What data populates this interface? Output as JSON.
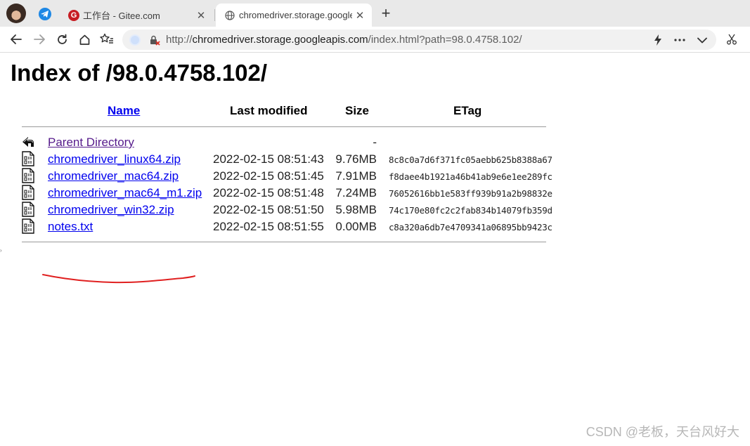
{
  "browser": {
    "tabs": [
      {
        "title": "工作台 - Gitee.com",
        "close": "✕",
        "favicon": "gitee-icon"
      },
      {
        "title": "chromedriver.storage.googleapis.com",
        "close": "✕",
        "favicon": "globe-icon"
      }
    ],
    "pinned_tab_icon": "telegram-icon",
    "new_tab": "+",
    "address": {
      "scheme": "http://",
      "host": "chromedriver.storage.googleapis.com",
      "path": "/index.html?path=98.0.4758.102/"
    },
    "toolbar_icons": [
      "back-icon",
      "forward-icon",
      "reload-icon",
      "home-icon",
      "favorites-icon",
      "lightning-icon",
      "more-icon",
      "chevron-down-icon",
      "scissors-icon"
    ]
  },
  "page": {
    "title": "Index of /98.0.4758.102/",
    "columns": {
      "name": "Name",
      "modified": "Last modified",
      "size": "Size",
      "etag": "ETag"
    },
    "parent": {
      "name": "Parent Directory",
      "size": "-"
    },
    "files": [
      {
        "name": "chromedriver_linux64.zip",
        "modified": "2022-02-15 08:51:43",
        "size": "9.76MB",
        "etag": "8c8c0a7d6f371fc05aebb625b8388a67"
      },
      {
        "name": "chromedriver_mac64.zip",
        "modified": "2022-02-15 08:51:45",
        "size": "7.91MB",
        "etag": "f8daee4b1921a46b41ab9e6e1ee289fc"
      },
      {
        "name": "chromedriver_mac64_m1.zip",
        "modified": "2022-02-15 08:51:48",
        "size": "7.24MB",
        "etag": "76052616bb1e583ff939b91a2b98832e"
      },
      {
        "name": "chromedriver_win32.zip",
        "modified": "2022-02-15 08:51:50",
        "size": "5.98MB",
        "etag": "74c170e80fc2c2fab834b14079fb359d"
      },
      {
        "name": "notes.txt",
        "modified": "2022-02-15 08:51:55",
        "size": "0.00MB",
        "etag": "c8a320a6db7e4709341a06895bb9423c"
      }
    ]
  },
  "watermark": "CSDN @老板，天台风好大",
  "colors": {
    "link": "#0000ee",
    "visited": "#551a8b",
    "annotation": "#e02020"
  }
}
